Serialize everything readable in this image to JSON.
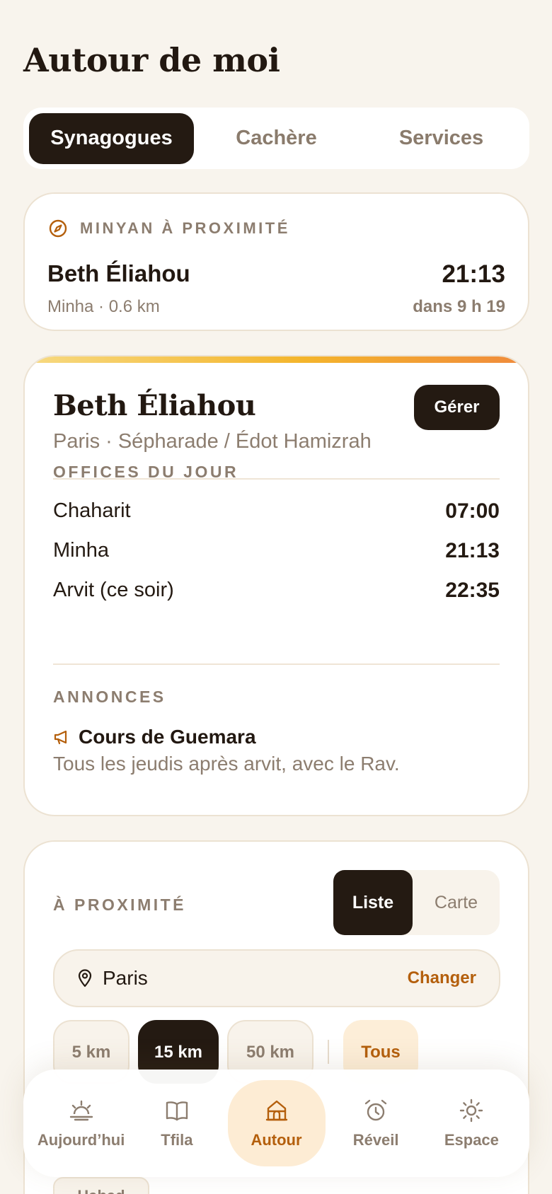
{
  "page": {
    "title": "Autour de moi"
  },
  "tabs": [
    "Synagogues",
    "Cachère",
    "Services"
  ],
  "minyan": {
    "label": "MINYAN À PROXIMITÉ",
    "name": "Beth Éliahou",
    "sub": "Minha · 0.6 km",
    "time": "21:13",
    "until": "dans 9 h 19"
  },
  "synagogue": {
    "name": "Beth Éliahou",
    "sub": "Paris · Sépharade / Édot Hamizrah",
    "manage_label": "Gérer",
    "offices_label": "OFFICES DU JOUR",
    "offices": [
      {
        "name": "Chaharit",
        "time": "07:00"
      },
      {
        "name": "Minha",
        "time": "21:13"
      },
      {
        "name": "Arvit (ce soir)",
        "time": "22:35"
      }
    ],
    "announces_label": "ANNONCES",
    "announce": {
      "title": "Cours de Guemara",
      "body": "Tous les jeudis après arvit, avec le Rav."
    }
  },
  "nearby": {
    "label": "À PROXIMITÉ",
    "view_options": [
      "Liste",
      "Carte"
    ],
    "location": {
      "city": "Paris",
      "change_label": "Changer"
    },
    "distances": [
      "5 km",
      "15 km",
      "50 km"
    ],
    "filter_all": "Tous",
    "rite_chip": "Habad"
  },
  "nav": [
    "Aujourd’hui",
    "Tfila",
    "Autour",
    "Réveil",
    "Espace"
  ],
  "colors": {
    "accent": "#b45f0c",
    "dark": "#241a12",
    "background": "#f8f4ed"
  }
}
